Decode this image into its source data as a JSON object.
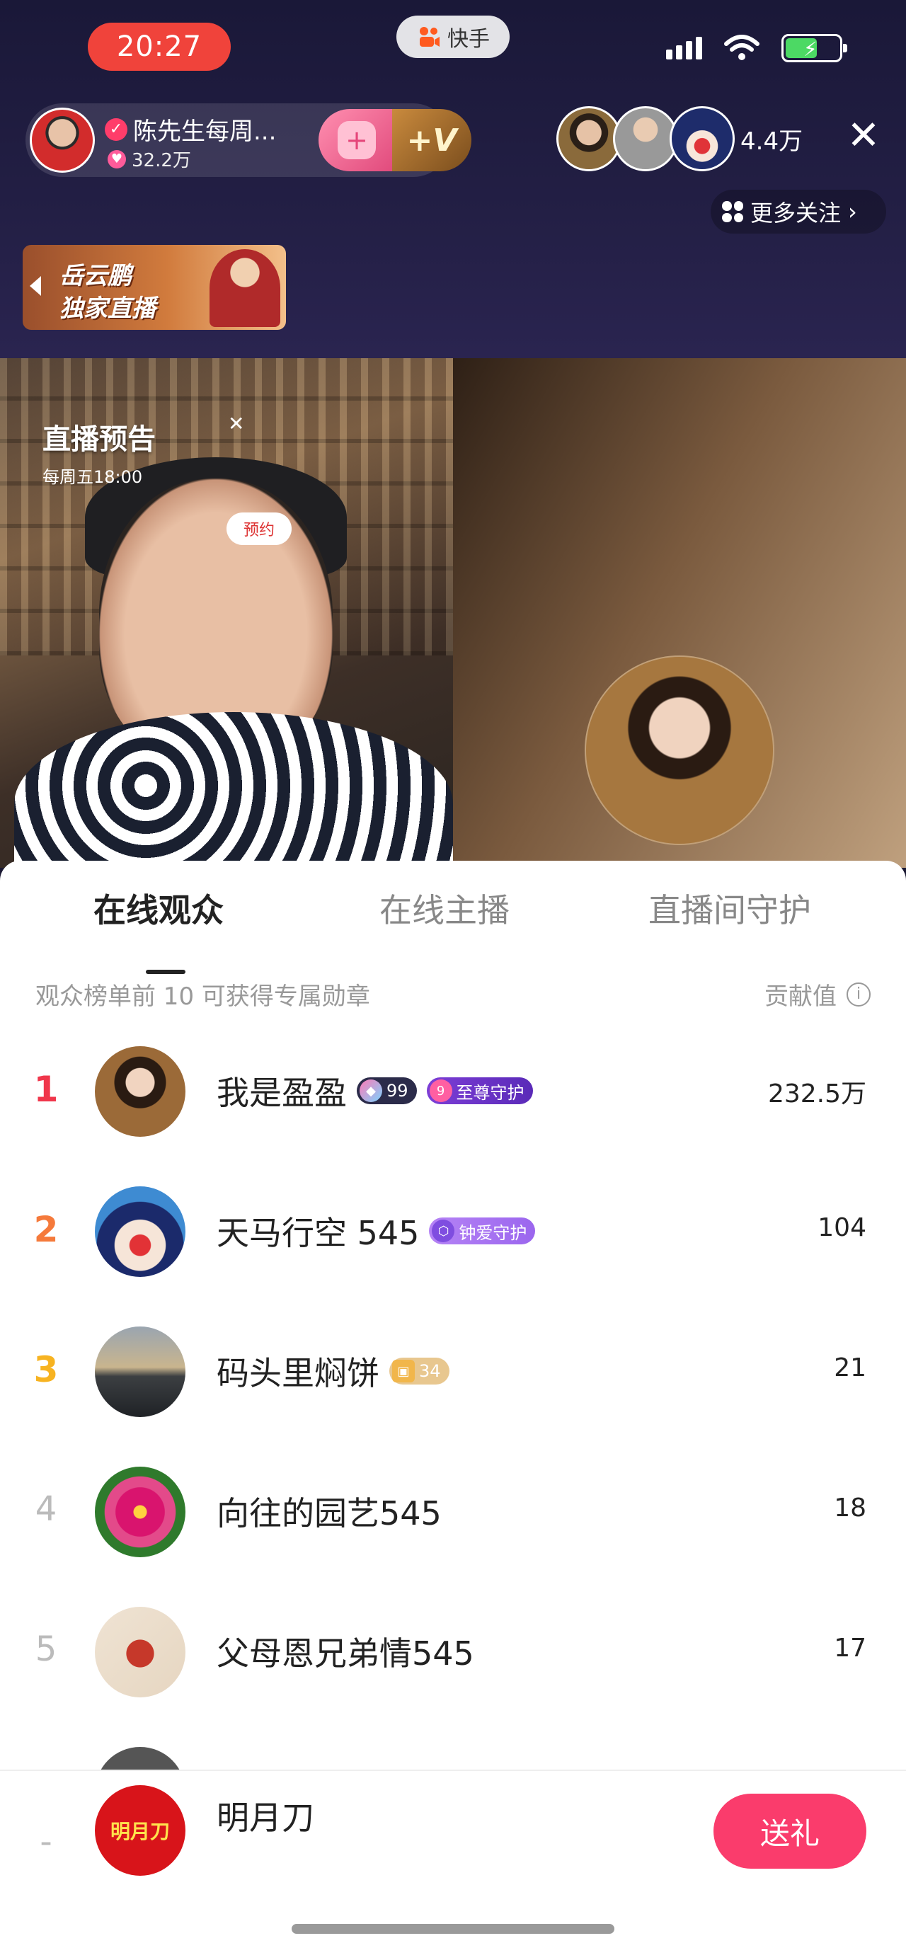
{
  "status_bar": {
    "time": "20:27",
    "app_name": "快手"
  },
  "host": {
    "name": "陈先生每周...",
    "fans": "32.2万",
    "vip_label": "+V"
  },
  "viewers": {
    "count": "4.4万"
  },
  "more_follow_label": "更多关注",
  "banner": {
    "line1": "岳云鹏",
    "line2": "独家直播"
  },
  "preview": {
    "title": "直播预告",
    "schedule": "每周五18:00",
    "reserve_label": "预约"
  },
  "tabs": [
    {
      "label": "在线观众",
      "active": true
    },
    {
      "label": "在线主播",
      "active": false
    },
    {
      "label": "直播间守护",
      "active": false
    }
  ],
  "sub_header": {
    "note": "观众榜单前 10 可获得专属勋章",
    "contribution_label": "贡献值"
  },
  "audience": [
    {
      "rank": "1",
      "name": "我是盈盈",
      "badges": [
        {
          "type": "level",
          "text": "99"
        },
        {
          "type": "supreme",
          "text": "至尊守护",
          "icon_text": "9"
        }
      ],
      "score": "232.5万"
    },
    {
      "rank": "2",
      "name": "天马行空 545",
      "badges": [
        {
          "type": "love",
          "text": "钟爱守护"
        }
      ],
      "score": "104"
    },
    {
      "rank": "3",
      "name": "码头里焖饼",
      "badges": [
        {
          "type": "fan",
          "text": "34"
        }
      ],
      "score": "21"
    },
    {
      "rank": "4",
      "name": "向往的园艺545",
      "badges": [],
      "score": "18"
    },
    {
      "rank": "5",
      "name": "父母恩兄弟情545",
      "badges": [],
      "score": "17"
    }
  ],
  "me": {
    "rank": "-",
    "name": "明月刀",
    "avatar_text": "明月刀",
    "gift_label": "送礼"
  },
  "colors": {
    "accent": "#fa3c6c",
    "rank1": "#f0364b",
    "rank2": "#f57a3b",
    "rank3": "#f7b321"
  }
}
